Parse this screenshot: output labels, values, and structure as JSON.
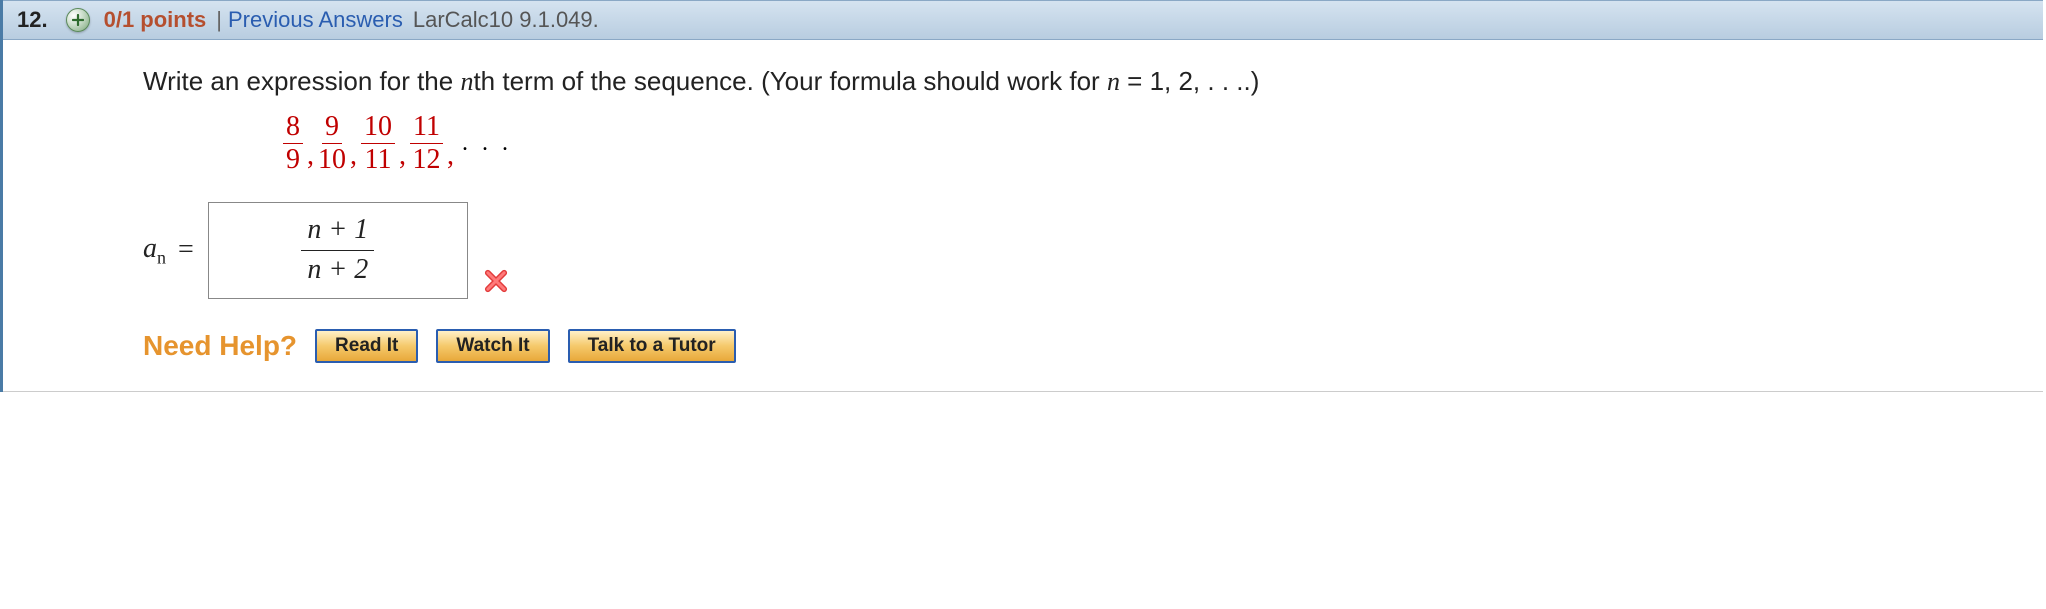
{
  "header": {
    "number": "12.",
    "points": "0/1 points",
    "separator": "|",
    "prev_answers": "Previous Answers",
    "reference": "LarCalc10 9.1.049."
  },
  "prompt": {
    "text_prefix": "Write an expression for the ",
    "nth": "n",
    "text_mid": "th term of the sequence. (Your formula should work for ",
    "n_eq": "n",
    "text_suffix": " = 1, 2, . . ..)"
  },
  "sequence": [
    {
      "num": "8",
      "den": "9"
    },
    {
      "num": "9",
      "den": "10"
    },
    {
      "num": "10",
      "den": "11"
    },
    {
      "num": "11",
      "den": "12"
    }
  ],
  "answer": {
    "label_a": "a",
    "label_sub": "n",
    "equals": "=",
    "numerator": "n + 1",
    "denominator": "n + 2",
    "correct": false
  },
  "help": {
    "label": "Need Help?",
    "buttons": [
      "Read It",
      "Watch It",
      "Talk to a Tutor"
    ]
  }
}
